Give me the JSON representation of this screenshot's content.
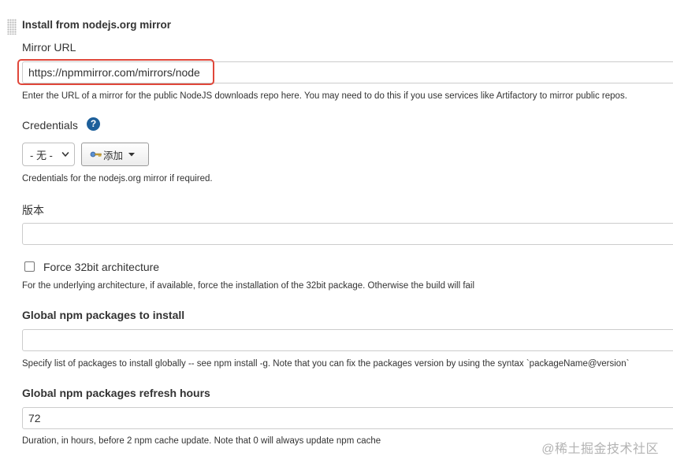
{
  "section": {
    "title": "Install from nodejs.org mirror"
  },
  "mirror_url": {
    "label": "Mirror URL",
    "value": "https://npmmirror.com/mirrors/node",
    "help": "Enter the URL of a mirror for the public NodeJS downloads repo here. You may need to do this if you use services like Artifactory to mirror public repos."
  },
  "credentials": {
    "label": "Credentials",
    "help_icon": "?",
    "select_value": "- 无 -",
    "add_label": "添加",
    "help": "Credentials for the nodejs.org mirror if required."
  },
  "version": {
    "label": "版本",
    "value": ""
  },
  "force32": {
    "label": "Force 32bit architecture",
    "checked": false,
    "help": "For the underlying architecture, if available, force the installation of the 32bit package. Otherwise the build will fail"
  },
  "npm_packages": {
    "label": "Global npm packages to install",
    "value": "",
    "help": "Specify list of packages to install globally -- see npm install -g. Note that you can fix the packages version by using the syntax `packageName@version`"
  },
  "refresh_hours": {
    "label": "Global npm packages refresh hours",
    "value": "72",
    "help": "Duration, in hours, before 2 npm cache update. Note that 0 will always update npm cache"
  },
  "watermark": "@稀土掘金技术社区",
  "colors": {
    "highlight": "#e0473a",
    "help_icon": "#1d5f9a",
    "input_border": "#cccccc"
  }
}
